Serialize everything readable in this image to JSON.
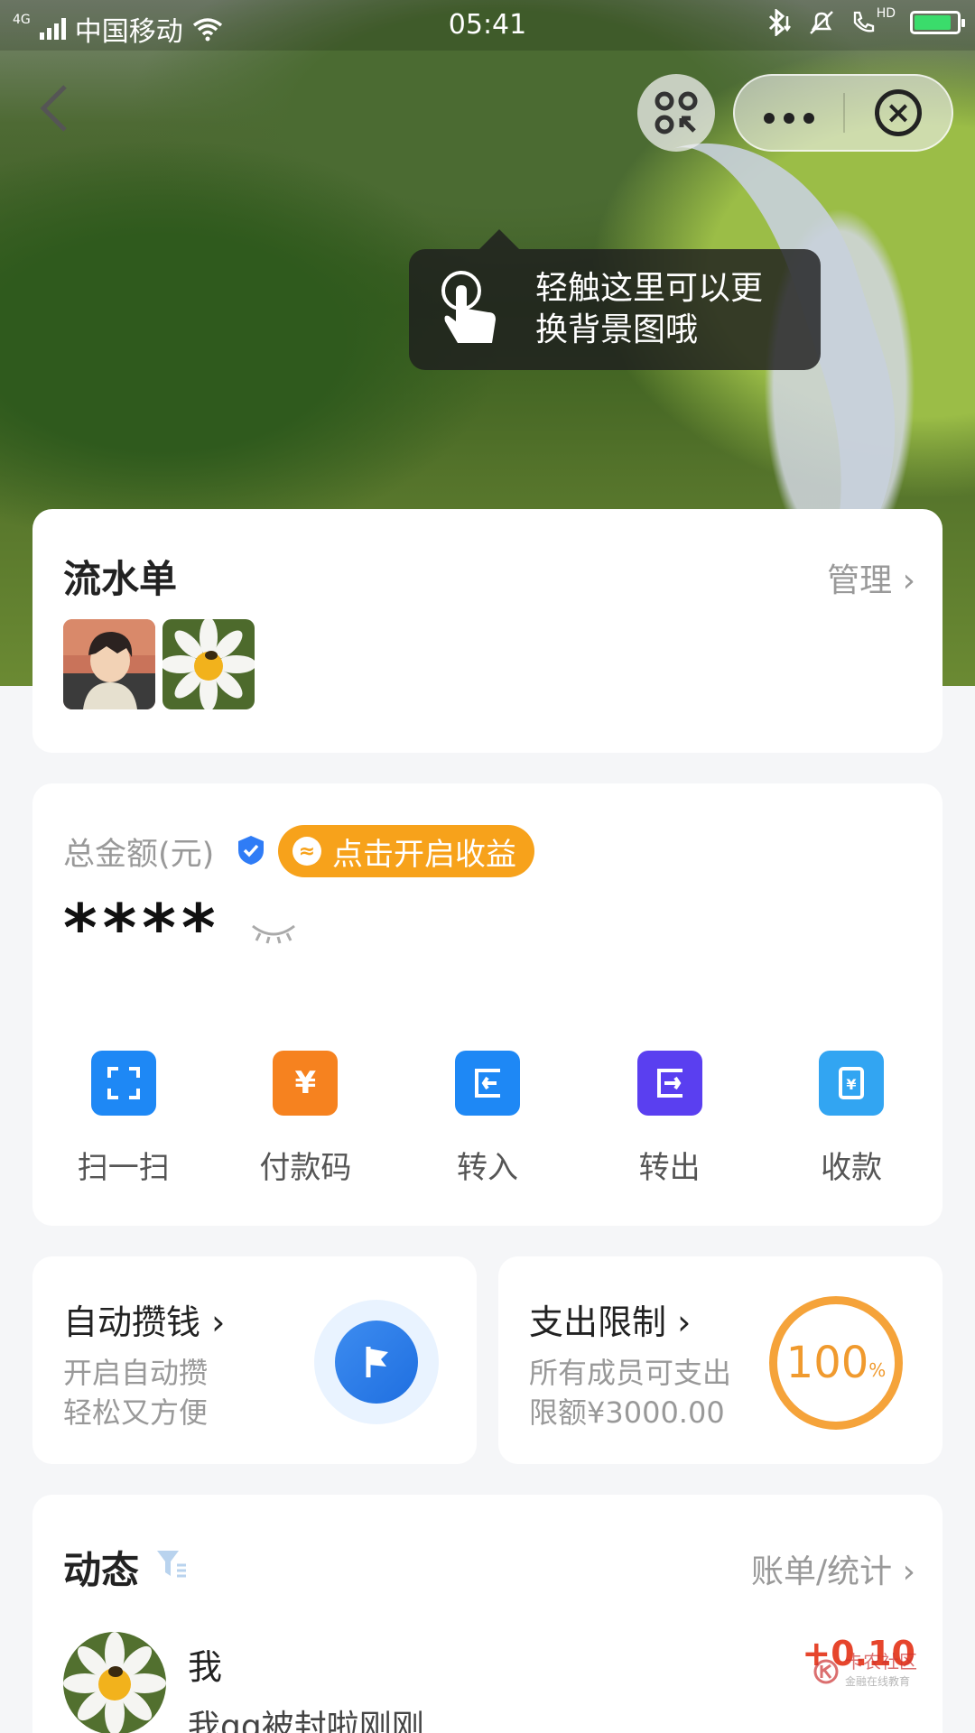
{
  "status_bar": {
    "network": "4G",
    "carrier": "中国移动",
    "time": "05:41",
    "hd": "HD"
  },
  "nav": {
    "back_icon": "chevron-left-icon",
    "scan_icon": "qr-scan-icon",
    "more_icon": "more-dots-icon",
    "close_icon": "close-circle-icon"
  },
  "tooltip": {
    "text": "轻触这里可以更换背景图哦"
  },
  "flow_card": {
    "title": "流水单",
    "manage": "管理 ›"
  },
  "balance": {
    "label": "总金额(元)",
    "earn_button": "点击开启收益",
    "masked_value": "****"
  },
  "actions": [
    {
      "label": "扫一扫",
      "color": "#1e88f5",
      "glyph": "⛶"
    },
    {
      "label": "付款码",
      "color": "#f6821f",
      "glyph": "¥"
    },
    {
      "label": "转入",
      "color": "#1e88f5",
      "glyph": "⇤"
    },
    {
      "label": "转出",
      "color": "#5a3ff0",
      "glyph": "⇥"
    },
    {
      "label": "收款",
      "color": "#32a5f2",
      "glyph": "¥"
    }
  ],
  "auto_save": {
    "title": "自动攒钱 ›",
    "line1": "开启自动攒",
    "line2": "轻松又方便"
  },
  "spend_limit": {
    "title": "支出限制 ›",
    "line1": "所有成员可支出",
    "line2": "限额¥3000.00",
    "percent": "100",
    "percent_sign": "%"
  },
  "feed": {
    "title": "动态",
    "stats": "账单/统计 ›",
    "item_name": "我",
    "item_memo": "我qq被封啦刚刚",
    "item_amount": "+0.10"
  },
  "watermark": {
    "text": "卡农社区",
    "sub": "金融在线教育"
  }
}
